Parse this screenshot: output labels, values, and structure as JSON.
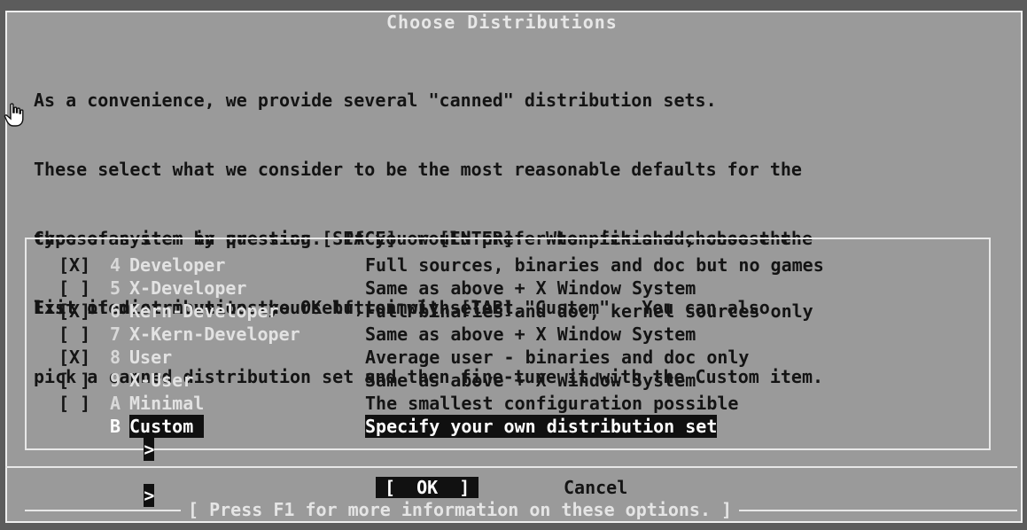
{
  "dialog": {
    "title": "Choose Distributions",
    "intro_lines": [
      "As a convenience, we provide several \"canned\" distribution sets.",
      "These select what we consider to be the most reasonable defaults for the",
      "type of system in question.  If you would prefer to pick and choose the",
      "list of distributions yourself, simply select \"Custom\".  You can also",
      "pick a canned distribution set and then fine-tune it with the Custom item."
    ],
    "instruction_lines": [
      "Choose an item by pressing [SPACE] or [ENTER].  When finished, choose the",
      "Exit item or move to the OK button with [TAB]."
    ]
  },
  "menu": {
    "items": [
      {
        "mark": "[X]",
        "key": "4",
        "name": "Developer",
        "description": "Full sources, binaries and doc but no games"
      },
      {
        "mark": "[ ]",
        "key": "5",
        "name": "X-Developer",
        "description": "Same as above + X Window System"
      },
      {
        "mark": "[X]",
        "key": "6",
        "name": "Kern-Developer",
        "description": "Full binaries and doc, kernel sources only"
      },
      {
        "mark": "[ ]",
        "key": "7",
        "name": "X-Kern-Developer",
        "description": "Same as above + X Window System"
      },
      {
        "mark": "[X]",
        "key": "8",
        "name": "User",
        "description": "Average user - binaries and doc only"
      },
      {
        "mark": "[ ]",
        "key": "9",
        "name": "X-User",
        "description": "Same as above + X Window System"
      },
      {
        "mark": "[ ]",
        "key": "A",
        "name": "Minimal",
        "description": "The smallest configuration possible"
      },
      {
        "mark_a": ">",
        "mark_b": ">",
        "key": "B",
        "name": "Custom",
        "description": "Specify your own distribution set"
      }
    ]
  },
  "buttons": {
    "ok_label": "[  OK  ]",
    "cancel_label": "Cancel"
  },
  "footer": {
    "hint": "[ Press F1 for more information on these options. ]"
  },
  "icons": {
    "cursor": "hand-pointer-icon"
  },
  "colors": {
    "dialog_bg": "#9a9a9a",
    "highlight_bg": "#101010",
    "text": "#141414",
    "border": "#e8e8e8"
  }
}
